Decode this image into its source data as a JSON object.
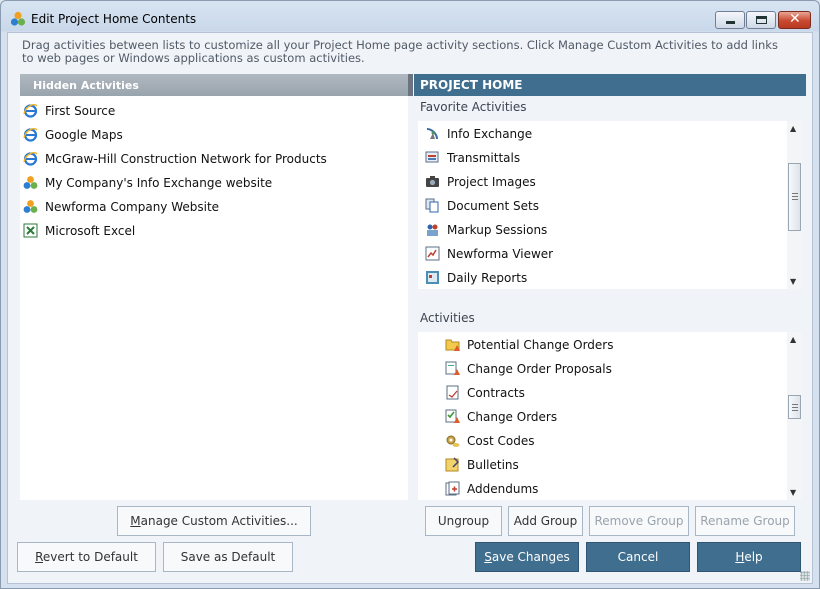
{
  "window": {
    "title": "Edit Project Home Contents"
  },
  "instructions": "Drag activities between lists to customize all your Project Home page activity sections.  Click Manage Custom Activities to add links to web pages or Windows applications as custom activities.",
  "hidden": {
    "header": "Hidden Activities",
    "items": [
      {
        "label": "First Source",
        "icon": "internet-explorer-icon"
      },
      {
        "label": "Google Maps",
        "icon": "internet-explorer-icon"
      },
      {
        "label": "McGraw-Hill Construction Network for Products",
        "icon": "internet-explorer-icon"
      },
      {
        "label": "My Company's Info Exchange website",
        "icon": "newforma-icon"
      },
      {
        "label": "Newforma Company Website",
        "icon": "newforma-icon"
      },
      {
        "label": "Microsoft Excel",
        "icon": "excel-icon"
      }
    ]
  },
  "project_home": {
    "header": "PROJECT HOME",
    "favorites": {
      "label": "Favorite Activities",
      "items": [
        {
          "label": "Info Exchange",
          "icon": "satellite-dish-icon"
        },
        {
          "label": "Transmittals",
          "icon": "transmittal-icon"
        },
        {
          "label": "Project Images",
          "icon": "camera-icon"
        },
        {
          "label": "Document Sets",
          "icon": "document-set-icon"
        },
        {
          "label": "Markup Sessions",
          "icon": "markup-session-icon"
        },
        {
          "label": "Newforma Viewer",
          "icon": "viewer-icon"
        },
        {
          "label": "Daily Reports",
          "icon": "daily-report-icon"
        }
      ]
    },
    "activities": {
      "label": "Activities",
      "items": [
        {
          "label": "Potential Change Orders",
          "icon": "folder-warning-icon"
        },
        {
          "label": "Change Order Proposals",
          "icon": "proposal-warning-icon"
        },
        {
          "label": "Contracts",
          "icon": "contract-icon"
        },
        {
          "label": "Change Orders",
          "icon": "change-order-icon"
        },
        {
          "label": "Cost Codes",
          "icon": "gear-coins-icon"
        },
        {
          "label": "Bulletins",
          "icon": "bulletin-icon"
        },
        {
          "label": "Addendums",
          "icon": "addendum-icon"
        }
      ]
    }
  },
  "buttons": {
    "manage_pre": "",
    "manage_u": "M",
    "manage_post": "anage Custom Activities...",
    "ungroup": "Ungroup",
    "add_group": "Add Group",
    "remove_group": "Remove Group",
    "rename_group": "Rename Group",
    "revert_u": "R",
    "revert_post": "evert to Default",
    "save_default": "Save as Default",
    "save_changes_u": "S",
    "save_changes_post": "ave Changes",
    "cancel": "Cancel",
    "help_u": "H",
    "help_post": "elp"
  }
}
